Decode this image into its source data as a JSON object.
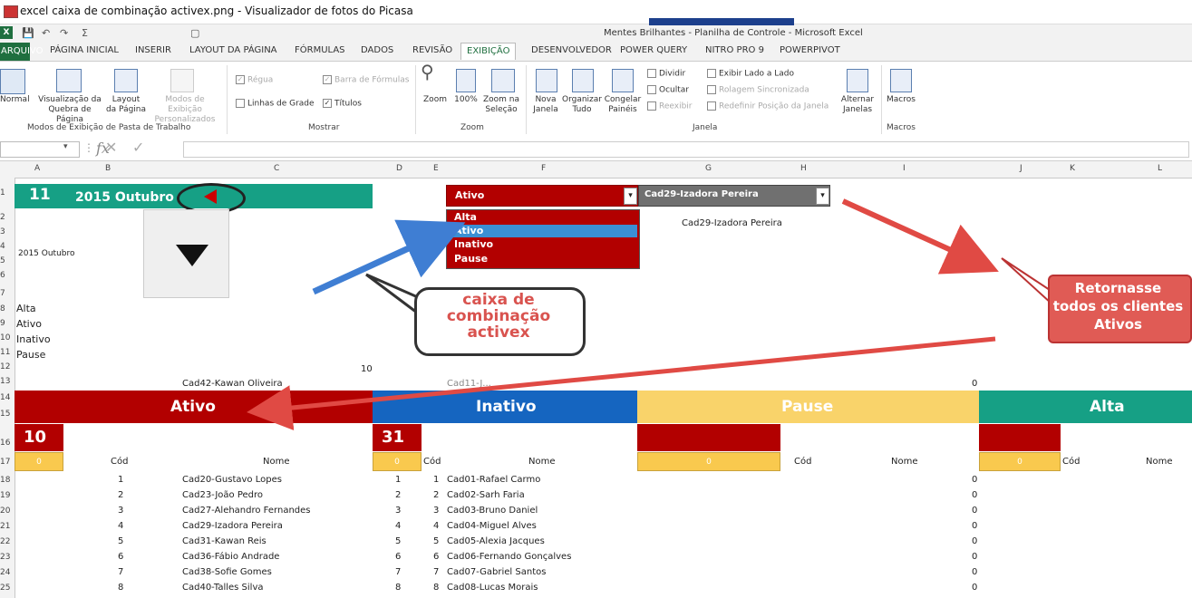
{
  "window": {
    "title": "excel caixa de combinação activex.png - Visualizador de fotos do Picasa"
  },
  "excel": {
    "title": "Mentes Brilhantes - Planilha de Controle - Microsoft Excel"
  },
  "tabs": [
    "ARQUIVO",
    "PÁGINA INICIAL",
    "INSERIR",
    "LAYOUT DA PÁGINA",
    "FÓRMULAS",
    "DADOS",
    "REVISÃO",
    "EXIBIÇÃO",
    "DESENVOLVEDOR",
    "POWER QUERY",
    "NITRO PRO 9",
    "POWERPIVOT"
  ],
  "ribbon": {
    "normal": "Normal",
    "visualizacao": [
      "Visualização da",
      "Quebra de Página"
    ],
    "layout": [
      "Layout",
      "da Página"
    ],
    "modos": [
      "Modos de Exibição",
      "Personalizados"
    ],
    "group_modos": "Modos de Exibição de Pasta de Trabalho",
    "regua": "Régua",
    "barra": "Barra de Fórmulas",
    "linhas": "Linhas de Grade",
    "titulos": "Títulos",
    "group_mostrar": "Mostrar",
    "zoom": "Zoom",
    "zoom100": "100%",
    "zoomsel": [
      "Zoom na",
      "Seleção"
    ],
    "group_zoom": "Zoom",
    "nova": [
      "Nova",
      "Janela"
    ],
    "organizar": [
      "Organizar",
      "Tudo"
    ],
    "congelar": [
      "Congelar",
      "Painéis"
    ],
    "dividir": "Dividir",
    "ocultar": "Ocultar",
    "reexibir": "Reexibir",
    "exibir_lado": "Exibir Lado a Lado",
    "rolagem": "Rolagem Sincronizada",
    "redefinir": "Redefinir Posição da Janela",
    "group_janela": "Janela",
    "alternar": [
      "Alternar",
      "Janelas"
    ],
    "macros": "Macros",
    "group_macros": "Macros"
  },
  "formula": {
    "fx": "fx"
  },
  "columns": [
    "A",
    "B",
    "C",
    "D",
    "E",
    "F",
    "G",
    "H",
    "I",
    "J",
    "K",
    "L"
  ],
  "rows": [
    "1",
    "2",
    "3",
    "4",
    "5",
    "6",
    "7",
    "8",
    "9",
    "10",
    "11",
    "12",
    "13",
    "14",
    "15",
    "16",
    "17",
    "18",
    "19",
    "20",
    "21",
    "22",
    "23",
    "24",
    "25"
  ],
  "sheet": {
    "top_value": "11",
    "top_month": "2015 Outubro",
    "month_small": "2015 Outubro",
    "status_list": [
      "Alta",
      "Ativo",
      "Inativo",
      "Pause"
    ],
    "row12_value": "10",
    "row13_name": "Cad42-Kawan Oliveira",
    "row13_name2": "Cad11-J...",
    "row13_zero": "0",
    "selected_client_label": "Cad29-Izadora Pereira"
  },
  "combo_status": {
    "value": "Ativo",
    "options": [
      "Alta",
      "Ativo",
      "Inativo",
      "Pause"
    ],
    "selected_index": 1
  },
  "combo_client": {
    "value": "Cad29-Izadora Pereira"
  },
  "sections": {
    "ativo": {
      "label": "Ativo",
      "count": "10",
      "box": "0"
    },
    "inativo": {
      "label": "Inativo",
      "count": "31",
      "box": "0"
    },
    "pause": {
      "label": "Pause",
      "box": "0"
    },
    "alta": {
      "label": "Alta",
      "box": "0"
    }
  },
  "headers": {
    "cod": "Cód",
    "nome": "Nome"
  },
  "ativo_list": [
    {
      "cod": "1",
      "nome": "Cad20-Gustavo Lopes"
    },
    {
      "cod": "2",
      "nome": "Cad23-João Pedro"
    },
    {
      "cod": "3",
      "nome": "Cad27-Alehandro Fernandes"
    },
    {
      "cod": "4",
      "nome": "Cad29-Izadora Pereira"
    },
    {
      "cod": "5",
      "nome": "Cad31-Kawan Reis"
    },
    {
      "cod": "6",
      "nome": "Cad36-Fábio Andrade"
    },
    {
      "cod": "7",
      "nome": "Cad38-Sofie Gomes"
    },
    {
      "cod": "8",
      "nome": "Cad40-Talles Silva"
    }
  ],
  "inativo_list": [
    {
      "n": "1",
      "cod": "1",
      "nome": "Cad01-Rafael Carmo"
    },
    {
      "n": "2",
      "cod": "2",
      "nome": "Cad02-Sarh Faria"
    },
    {
      "n": "3",
      "cod": "3",
      "nome": "Cad03-Bruno Daniel"
    },
    {
      "n": "4",
      "cod": "4",
      "nome": "Cad04-Miguel Alves"
    },
    {
      "n": "5",
      "cod": "5",
      "nome": "Cad05-Alexia Jacques"
    },
    {
      "n": "6",
      "cod": "6",
      "nome": "Cad06-Fernando Gonçalves"
    },
    {
      "n": "7",
      "cod": "7",
      "nome": "Cad07-Gabriel Santos"
    },
    {
      "n": "8",
      "cod": "8",
      "nome": "Cad08-Lucas Morais"
    }
  ],
  "zeros": [
    "0",
    "0",
    "0",
    "0",
    "0",
    "0",
    "0",
    "0"
  ],
  "callouts": {
    "activex": "caixa de combinação activex",
    "retorno": "Retornasse todos os clientes Ativos"
  }
}
